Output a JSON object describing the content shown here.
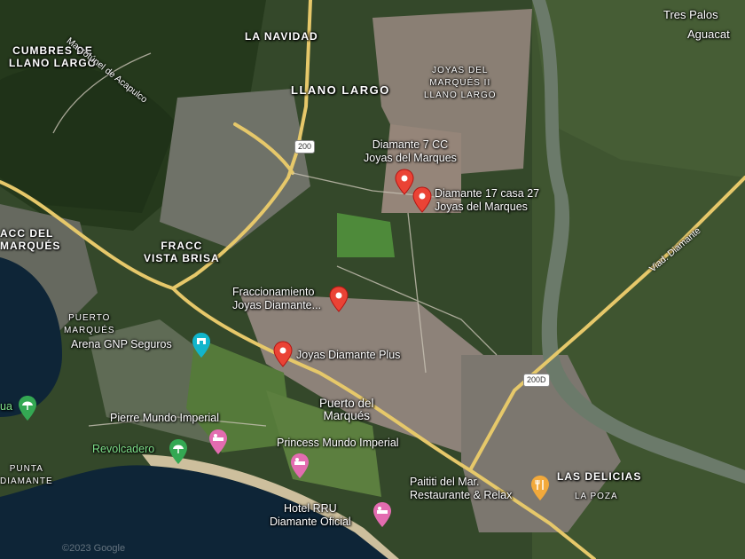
{
  "colors": {
    "water": "#0e2537",
    "road": "#e6c86a",
    "pin_red": "#ea4335",
    "pin_pink": "#e36cb0",
    "pin_orange": "#f2a93b",
    "pin_blue": "#1a73e8",
    "pin_green": "#34a853"
  },
  "areas": {
    "cumbres": "CUMBRES DE\nLLANO LARGO",
    "la_navidad": "LA NAVIDAD",
    "llano_largo": "LLANO LARGO",
    "joyas_ii": "JOYAS DEL\nMARQUÉS II\nLLANO LARGO",
    "fracc_marques": "ACC DEL\nMARQUÉS",
    "fracc_vista": "FRACC\nVISTA BRISA",
    "puerto_marques_area": "PUERTO\nMARQUÉS",
    "punta_diamante": "PUNTA\nDIAMANTE",
    "las_delicias": "LAS DELICIAS",
    "la_poza": "LA POZA"
  },
  "towns": {
    "tres_palos": "Tres Palos",
    "aguacat": "Aguacat",
    "puerto_del_marques": "Puerto del\nMarqués"
  },
  "roads": {
    "macrotunel": "Macrotúnel de Acapulco",
    "viad_diamante": "Viad. Diamante",
    "shield_200_north": "200",
    "shield_200d": "200D"
  },
  "markers": {
    "diamante7": "Diamante 7 CC\nJoyas del Marques",
    "diamante17": "Diamante 17 casa 27\nJoyas del Marques",
    "fraccionamiento": "Fraccionamiento\nJoyas Diamante...",
    "joyas_plus": "Joyas Diamante Plus",
    "arena": "Arena GNP Seguros",
    "pierre": "Pierre Mundo Imperial",
    "princess": "Princess Mundo Imperial",
    "hotel_rru": "Hotel RRU\nDiamante Oficial",
    "paititi": "Paititi del Mar.\nRestaurante & Relax",
    "revolcadero": "Revolcadero",
    "ua_label": "ua"
  },
  "icons": {
    "pin": "map-pin-icon",
    "hotel": "hotel-bed-icon",
    "restaurant": "restaurant-fork-knife-icon",
    "stadium": "stadium-icon",
    "beach": "beach-umbrella-icon"
  },
  "copyright": "©2023 Google"
}
